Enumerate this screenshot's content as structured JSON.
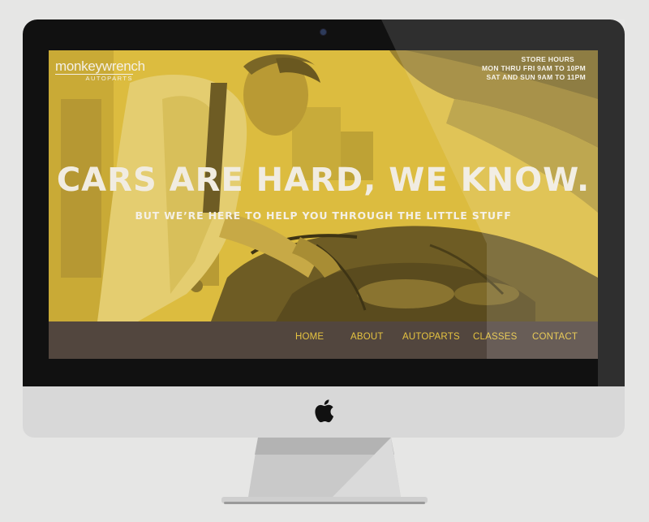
{
  "site": {
    "logo": {
      "name": "monkeywrench",
      "sub": "AUTOPARTS"
    },
    "store_hours": {
      "title": "STORE HOURS",
      "weekday": "MON THRU FRI 9AM TO 10PM",
      "weekend": "SAT AND SUN 9AM TO 11PM"
    },
    "hero": {
      "title": "CARS ARE HARD, WE KNOW.",
      "subtitle": "BUT WE’RE HERE TO HELP YOU THROUGH THE LITTLE STUFF"
    },
    "nav": {
      "items": [
        {
          "label": "HOME"
        },
        {
          "label": "ABOUT"
        },
        {
          "label": "AUTOPARTS"
        },
        {
          "label": "CLASSES"
        },
        {
          "label": "CONTACT"
        }
      ]
    }
  },
  "colors": {
    "page_background": "#e6e6e5",
    "bezel": "#111111",
    "hero_yellow": "#dcbc3f",
    "navbar": "#52463e",
    "nav_text": "#e6c440",
    "hero_text": "#f1ece1",
    "chin": "#d8d8d8"
  },
  "icons": {
    "device_logo": "apple-icon",
    "camera": "camera-icon"
  }
}
